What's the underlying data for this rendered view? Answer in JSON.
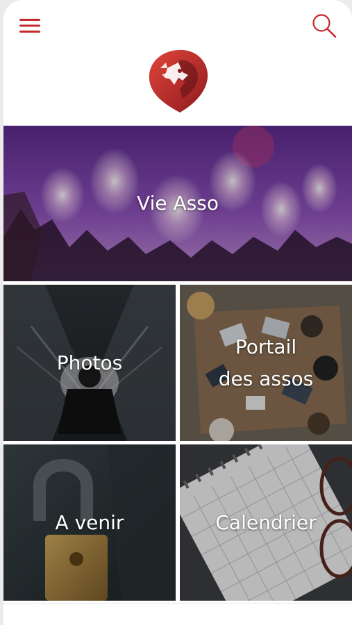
{
  "header": {
    "menu_icon": "hamburger-menu-icon",
    "search_icon": "search-icon",
    "logo_icon": "lion-head-logo",
    "accent_color": "#c7282d"
  },
  "tiles": [
    {
      "id": "vie-asso",
      "label": "Vie Asso",
      "image": "fireworks-concert-crowd"
    },
    {
      "id": "photos",
      "label": "Photos",
      "image": "person-on-escalator-smoke"
    },
    {
      "id": "portail",
      "label": "Portail\ndes assos",
      "image": "team-meeting-laptops"
    },
    {
      "id": "a-venir",
      "label": "A venir",
      "image": "padlock"
    },
    {
      "id": "calendrier",
      "label": "Calendrier",
      "image": "calendar-page-glasses"
    }
  ]
}
